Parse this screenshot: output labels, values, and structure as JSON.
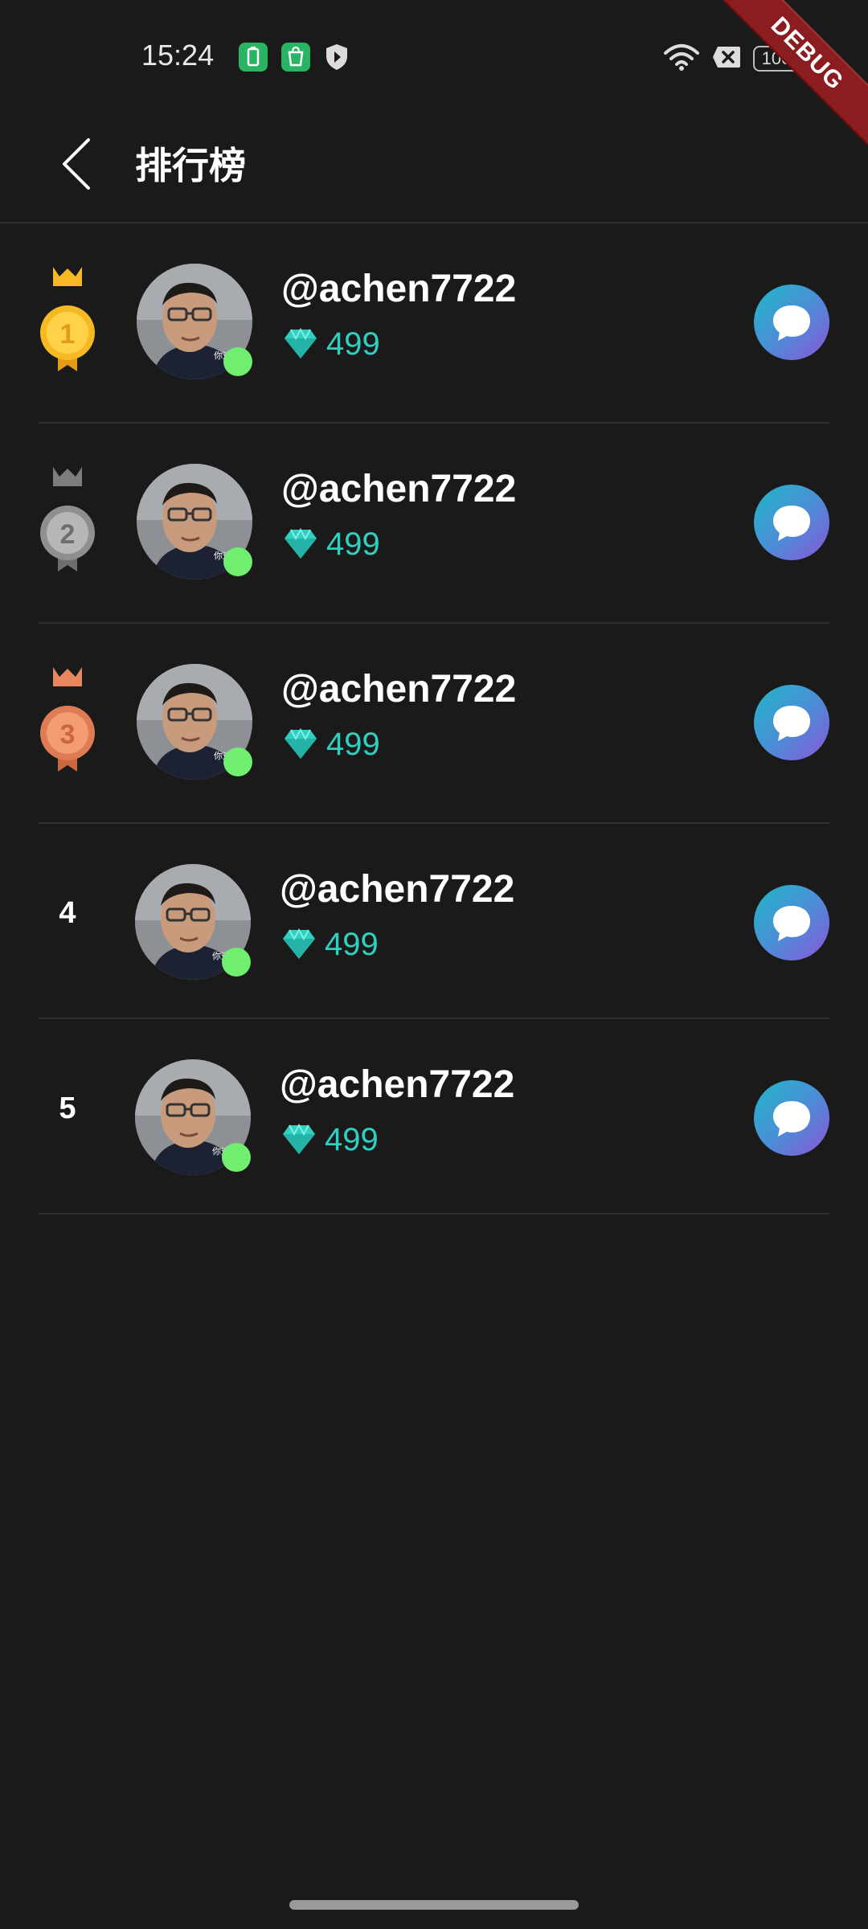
{
  "status_bar": {
    "time": "15:24",
    "battery": "100"
  },
  "debug_banner": "DEBUG",
  "header": {
    "title": "排行榜"
  },
  "colors": {
    "background": "#1a1a1a",
    "gem": "#2fd0c0",
    "online": "#6fee6f",
    "gold": "#f5b923",
    "silver": "#9b9b9b",
    "bronze": "#e8875f"
  },
  "ranking": [
    {
      "rank": "1",
      "medal": "gold-medal-icon",
      "username": "@achen7722",
      "gems": "499",
      "avatar_caption": "你这背景"
    },
    {
      "rank": "2",
      "medal": "silver-medal-icon",
      "username": "@achen7722",
      "gems": "499",
      "avatar_caption": "你这背景"
    },
    {
      "rank": "3",
      "medal": "bronze-medal-icon",
      "username": "@achen7722",
      "gems": "499",
      "avatar_caption": "你这背景"
    },
    {
      "rank": "4",
      "medal": "",
      "username": "@achen7722",
      "gems": "499",
      "avatar_caption": "你这背景"
    },
    {
      "rank": "5",
      "medal": "",
      "username": "@achen7722",
      "gems": "499",
      "avatar_caption": "你这背景"
    }
  ]
}
